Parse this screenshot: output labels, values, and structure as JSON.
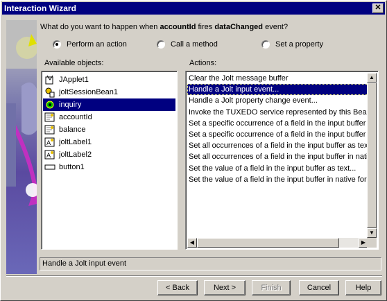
{
  "window": {
    "title": "Interaction Wizard"
  },
  "question": {
    "prefix": "What do you want to happen when",
    "source": "accountId",
    "fires": "fires",
    "event": "dataChanged",
    "suffix": "event?"
  },
  "options": [
    {
      "label": "Perform an action",
      "checked": true
    },
    {
      "label": "Call a method",
      "checked": false
    },
    {
      "label": "Set a property",
      "checked": false
    }
  ],
  "objects": {
    "label": "Available objects:",
    "items": [
      {
        "label": "JApplet1",
        "icon": "applet-icon",
        "selected": false
      },
      {
        "label": "joltSessionBean1",
        "icon": "session-bean-icon",
        "selected": false
      },
      {
        "label": "inquiry",
        "icon": "bean-gear-icon",
        "selected": true
      },
      {
        "label": "accountId",
        "icon": "field-bean-icon",
        "selected": false
      },
      {
        "label": "balance",
        "icon": "field-bean-icon",
        "selected": false
      },
      {
        "label": "joltLabel1",
        "icon": "label-bean-icon",
        "selected": false
      },
      {
        "label": "joltLabel2",
        "icon": "label-bean-icon",
        "selected": false
      },
      {
        "label": "button1",
        "icon": "button-icon",
        "selected": false
      }
    ]
  },
  "actions": {
    "label": "Actions:",
    "items": [
      {
        "label": "Clear the Jolt message buffer",
        "selected": false
      },
      {
        "label": "Handle a Jolt input event...",
        "selected": true
      },
      {
        "label": "Handle a Jolt property change event...",
        "selected": false
      },
      {
        "label": "Invoke the TUXEDO service represented by this Bean",
        "selected": false
      },
      {
        "label": "Set a specific occurrence of a field in the input buffer as",
        "selected": false
      },
      {
        "label": "Set a specific occurrence of a field in the input buffer in",
        "selected": false
      },
      {
        "label": "Set all occurrences of a field in the input buffer as text...",
        "selected": false
      },
      {
        "label": "Set all occurrences of a field in the input buffer in native",
        "selected": false
      },
      {
        "label": "Set the value of a field in the input buffer as text...",
        "selected": false
      },
      {
        "label": "Set the value of a field in the input buffer in native format",
        "selected": false
      }
    ]
  },
  "status": "Handle a Jolt input event",
  "buttons": {
    "back": "< Back",
    "next": "Next >",
    "finish": "Finish",
    "cancel": "Cancel",
    "help": "Help"
  },
  "colors": {
    "titlebar": "#000080",
    "selection": "#000080",
    "face": "#d4d0c8"
  }
}
